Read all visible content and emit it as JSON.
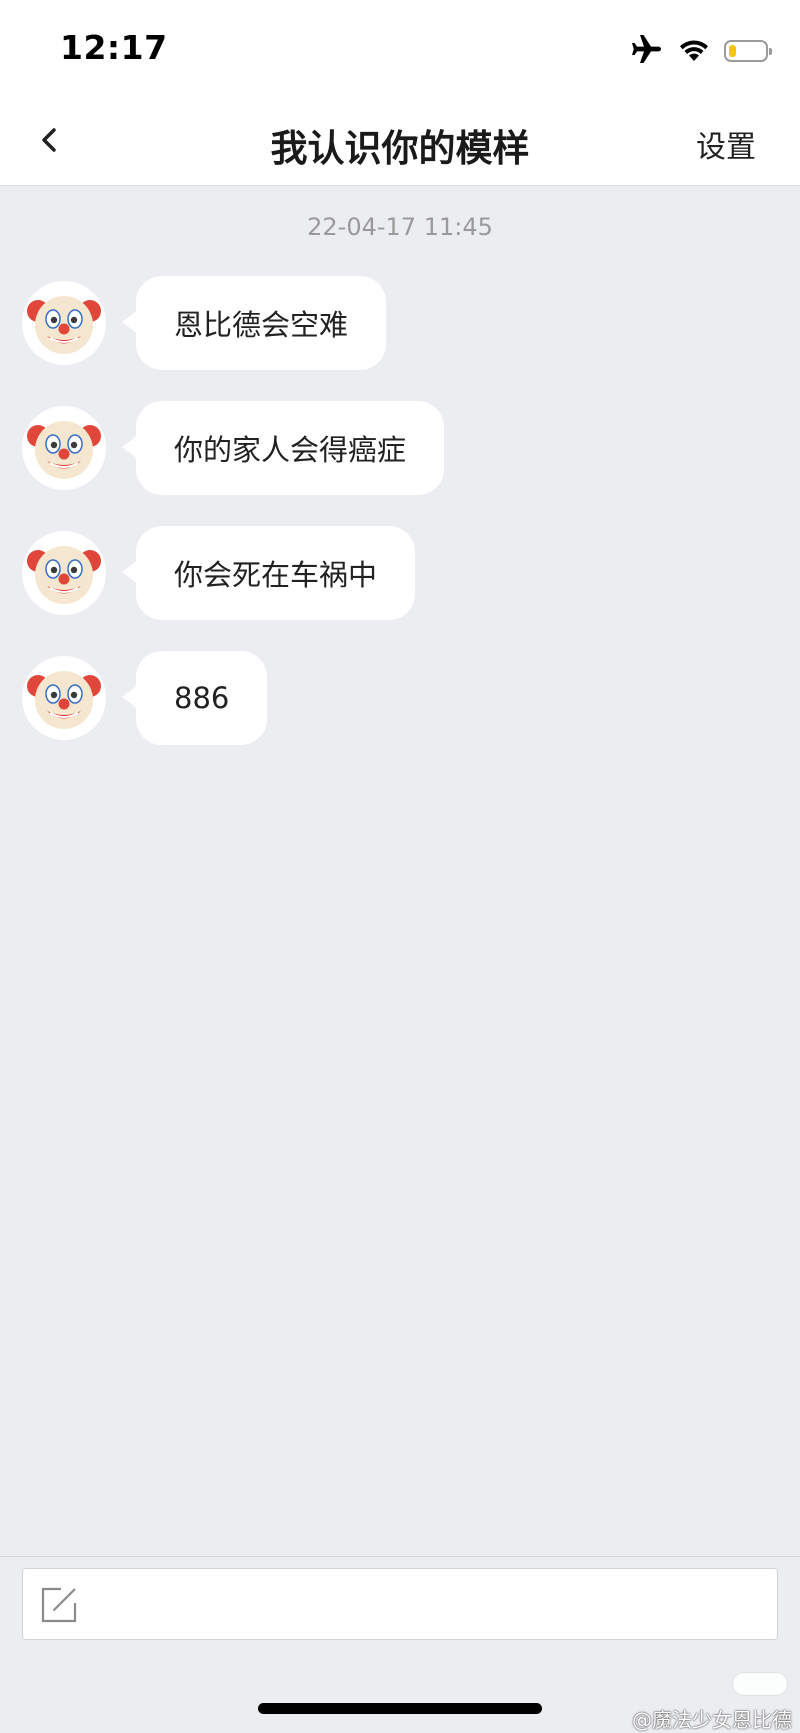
{
  "status_bar": {
    "time": "12:17",
    "icons": [
      "airplane-icon",
      "wifi-icon",
      "battery-icon"
    ],
    "battery_level": 0.2
  },
  "nav": {
    "back_icon": "chevron-left-icon",
    "title": "我认识你的模样",
    "settings_label": "设置"
  },
  "chat": {
    "timestamp": "22-04-17 11:45",
    "avatar_icon": "clown-face-icon",
    "messages": [
      {
        "text": "恩比德会空难"
      },
      {
        "text": "你的家人会得癌症"
      },
      {
        "text": "你会死在车祸中"
      },
      {
        "text": "886"
      }
    ]
  },
  "input": {
    "icon": "compose-icon",
    "value": ""
  },
  "watermark": {
    "text": "@魔法少女恩比德"
  },
  "colors": {
    "chat_background": "#ebedf0",
    "bubble": "#ffffff",
    "timestamp_text": "#9a9a9a",
    "battery_fill": "#f3c419"
  }
}
